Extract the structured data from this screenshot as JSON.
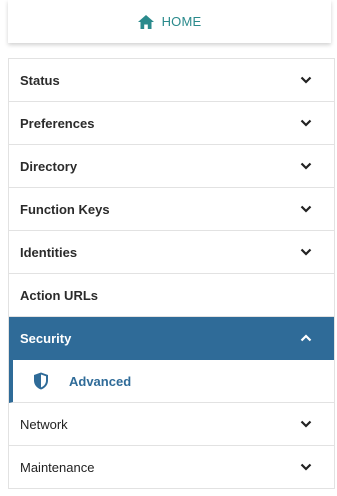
{
  "header": {
    "home_label": "HOME"
  },
  "menu": {
    "items": [
      {
        "label": "Status",
        "icon": "chevron-down-icon"
      },
      {
        "label": "Preferences",
        "icon": "chevron-down-icon"
      },
      {
        "label": "Directory",
        "icon": "chevron-down-icon"
      },
      {
        "label": "Function Keys",
        "icon": "chevron-down-icon"
      },
      {
        "label": "Identities",
        "icon": "chevron-down-icon"
      },
      {
        "label": "Action URLs"
      },
      {
        "label": "Security",
        "icon": "chevron-up-icon",
        "active": true
      },
      {
        "label": "Network",
        "icon": "chevron-down-icon"
      },
      {
        "label": "Maintenance",
        "icon": "chevron-down-icon"
      }
    ],
    "security_sub": {
      "label": "Advanced",
      "icon": "shield-icon"
    }
  },
  "colors": {
    "accent": "#2f6b98",
    "home_text": "#2a8a8c"
  }
}
